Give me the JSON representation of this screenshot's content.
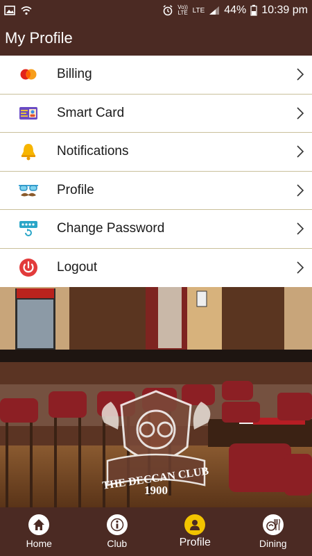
{
  "status_bar": {
    "battery": "44%",
    "time": "10:39 pm",
    "network": "LTE",
    "volte": "Vo)) LTE"
  },
  "header": {
    "title": "My Profile"
  },
  "menu": {
    "items": [
      {
        "label": "Billing",
        "icon": "credit-card-icon"
      },
      {
        "label": "Smart Card",
        "icon": "id-card-icon"
      },
      {
        "label": "Notifications",
        "icon": "bell-icon"
      },
      {
        "label": "Profile",
        "icon": "glasses-mustache-icon"
      },
      {
        "label": "Change Password",
        "icon": "password-reset-icon"
      },
      {
        "label": "Logout",
        "icon": "power-icon"
      }
    ]
  },
  "hero": {
    "logo_text": "THE DECCAN CLUB",
    "logo_year": "1900"
  },
  "tabs": [
    {
      "label": "Home",
      "icon": "home-icon",
      "active": false
    },
    {
      "label": "Club",
      "icon": "info-icon",
      "active": false
    },
    {
      "label": "Profile",
      "icon": "user-icon",
      "active": true
    },
    {
      "label": "Dining",
      "icon": "dining-icon",
      "active": false
    }
  ],
  "colors": {
    "brand": "#4b2a23",
    "accent": "#f2c400",
    "divider": "#c9bf9a"
  }
}
